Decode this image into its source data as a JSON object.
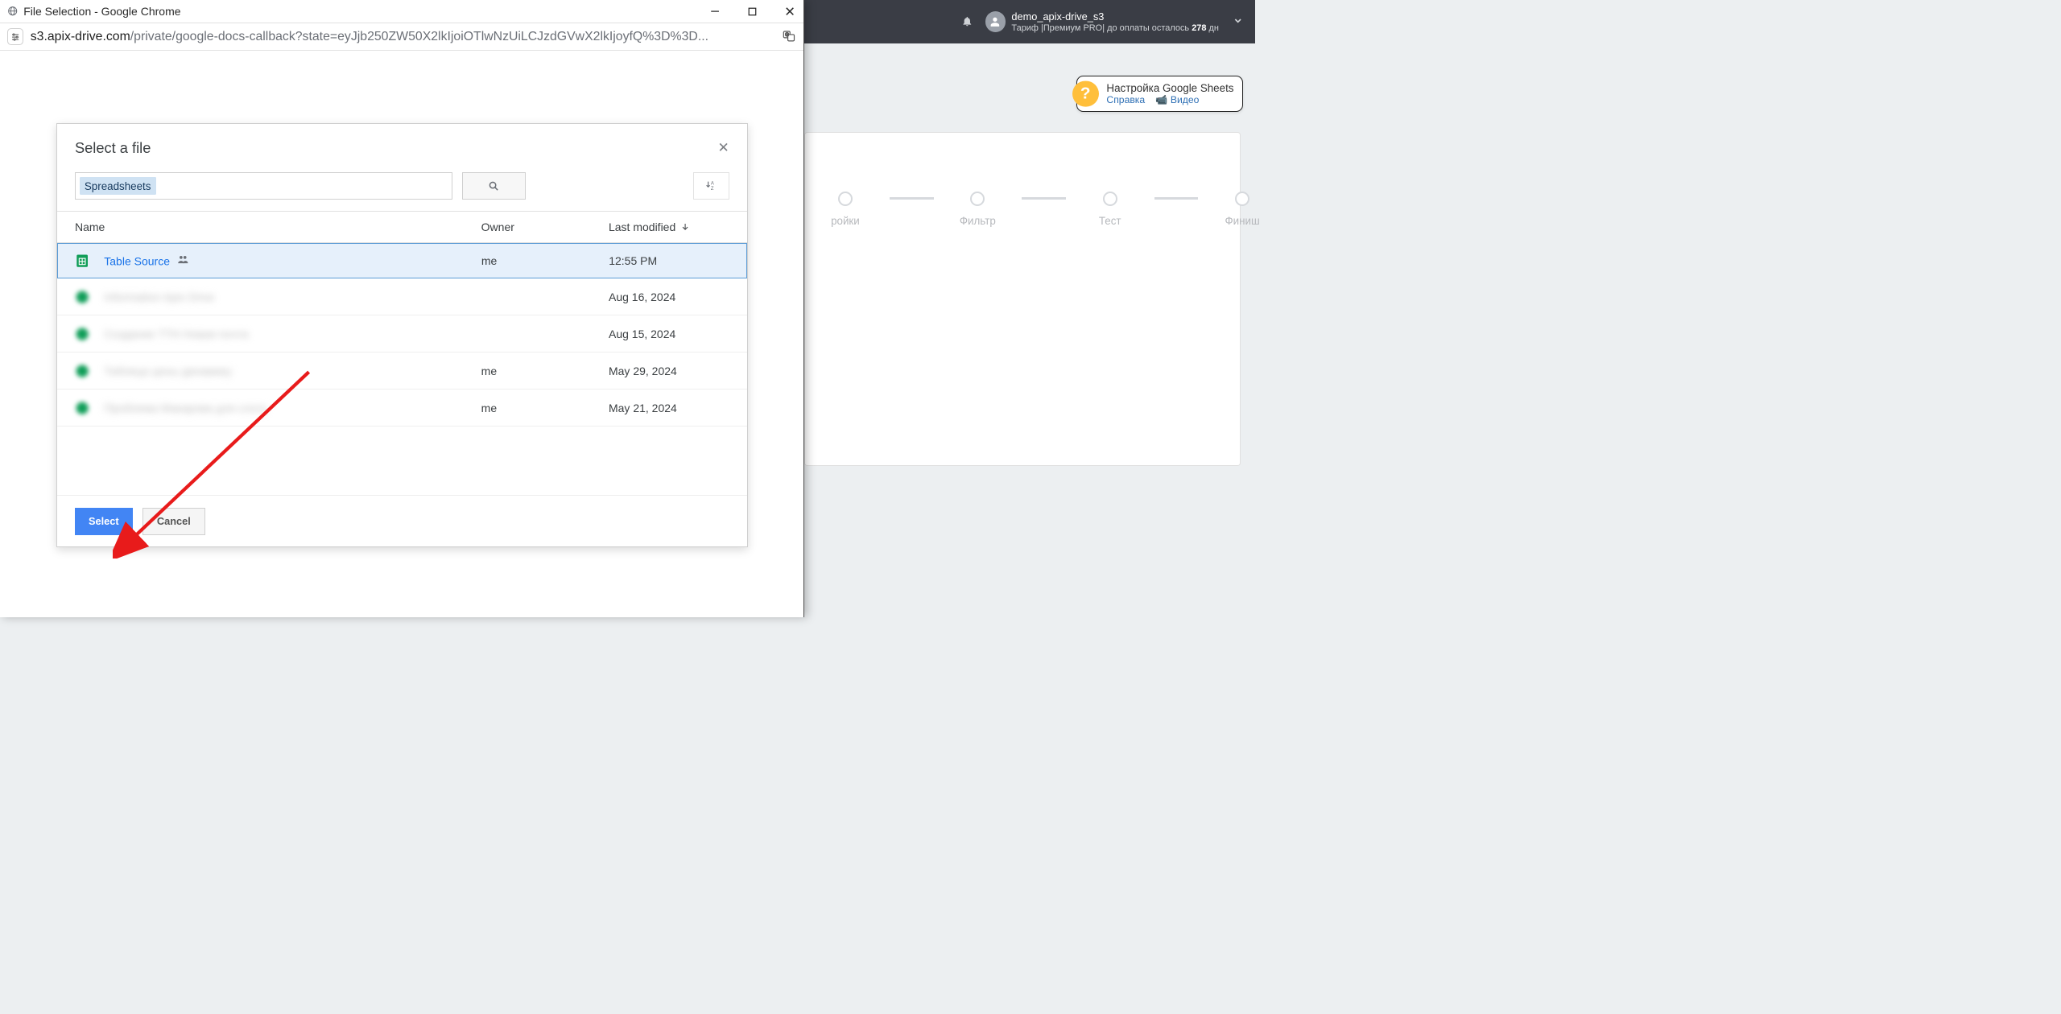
{
  "app": {
    "account_name": "demo_apix-drive_s3",
    "tariff_label": "Тариф |",
    "tariff_plan": "Премиум PRO",
    "tariff_sep": "| до оплаты осталось",
    "tariff_days": "278",
    "tariff_days_suffix": "дн"
  },
  "help": {
    "title": "Настройка Google Sheets",
    "link1": "Справка",
    "link2": "Видео"
  },
  "steps": [
    "ройки",
    "Фильтр",
    "Тест",
    "Финиш"
  ],
  "popup": {
    "window_title": "File Selection - Google Chrome",
    "url_host": "s3.apix-drive.com",
    "url_path": "/private/google-docs-callback?state=eyJjb250ZW50X2lkIjoiOTlwNzUiLCJzdGVwX2lkIjoyfQ%3D%3D..."
  },
  "picker": {
    "title": "Select a file",
    "search_chip": "Spreadsheets",
    "columns": {
      "name": "Name",
      "owner": "Owner",
      "modified": "Last modified"
    },
    "rows": [
      {
        "name": "Table Source",
        "owner": "me",
        "modified": "12:55 PM",
        "selected": true,
        "shared": true,
        "blur": false,
        "icon": "sheets"
      },
      {
        "name": "Information Apix Drive",
        "owner": "",
        "modified": "Aug 16, 2024",
        "selected": false,
        "shared": false,
        "blur": true,
        "icon": "sheets-green"
      },
      {
        "name": "Создание ТТН Новая почта",
        "owner": "",
        "modified": "Aug 15, 2024",
        "selected": false,
        "shared": false,
        "blur": true,
        "icon": "sheets-green"
      },
      {
        "name": "Таблица цены динамику",
        "owner": "me",
        "modified": "May 29, 2024",
        "selected": false,
        "shared": false,
        "blur": true,
        "icon": "sheets-green"
      },
      {
        "name": "Проблема Макарова для слоту",
        "owner": "me",
        "modified": "May 21, 2024",
        "selected": false,
        "shared": false,
        "blur": true,
        "icon": "sheets-green"
      }
    ],
    "select_btn": "Select",
    "cancel_btn": "Cancel"
  }
}
